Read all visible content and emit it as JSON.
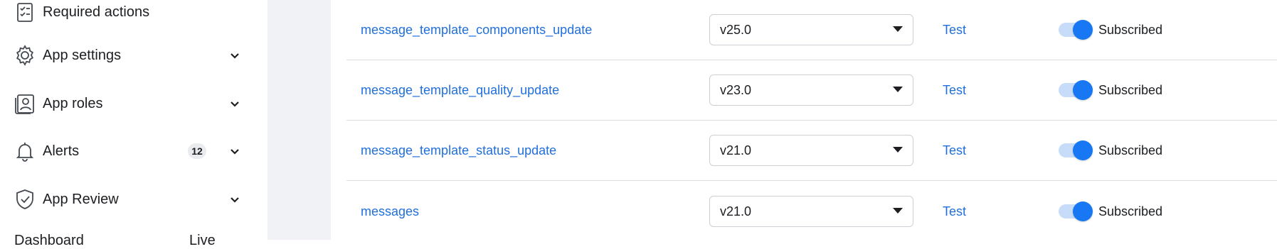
{
  "sidebar": {
    "items": [
      {
        "label": "Required actions",
        "icon": "checklist-icon"
      },
      {
        "label": "App settings",
        "icon": "gear-icon"
      },
      {
        "label": "App roles",
        "icon": "id-badge-icon"
      },
      {
        "label": "Alerts",
        "icon": "bell-icon",
        "badge": "12"
      },
      {
        "label": "App Review",
        "icon": "shield-check-icon"
      }
    ],
    "cut_off_left": "Dashboard",
    "cut_off_right": "Live"
  },
  "webhooks": {
    "rows": [
      {
        "field": "message_template_components_update",
        "version": "v25.0",
        "test": "Test",
        "status": "Subscribed"
      },
      {
        "field": "message_template_quality_update",
        "version": "v23.0",
        "test": "Test",
        "status": "Subscribed"
      },
      {
        "field": "message_template_status_update",
        "version": "v21.0",
        "test": "Test",
        "status": "Subscribed"
      },
      {
        "field": "messages",
        "version": "v21.0",
        "test": "Test",
        "status": "Subscribed"
      }
    ]
  },
  "colors": {
    "link": "#216fdb",
    "toggle_on": "#1877f2",
    "gutter": "#f0f2f5"
  }
}
